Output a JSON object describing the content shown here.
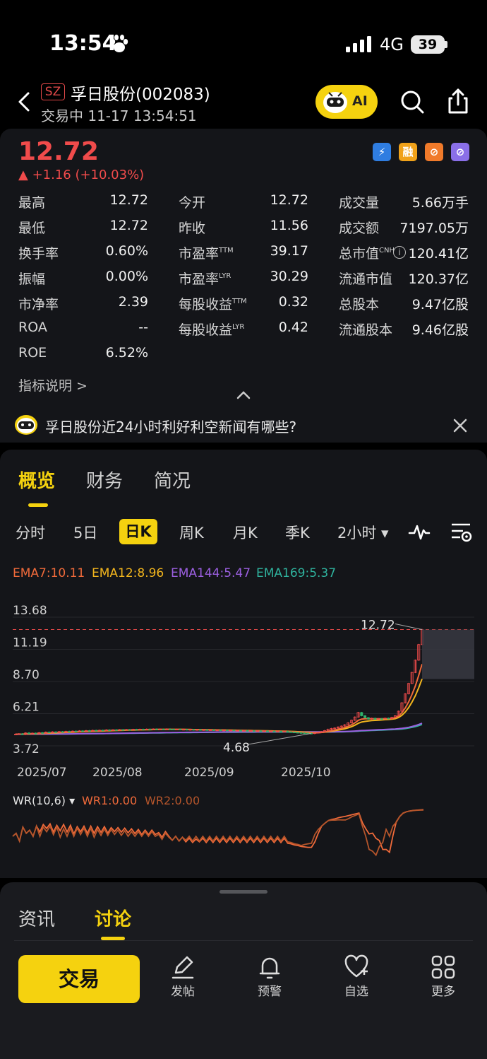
{
  "status": {
    "time": "13:54",
    "network": "4G",
    "battery": "39"
  },
  "header": {
    "market": "SZ",
    "name": "孚日股份(002083)",
    "subtitle": "交易中 11-17 13:54:51",
    "ai_label": "AI"
  },
  "quote": {
    "price": "12.72",
    "change": "▲ +1.16 (+10.03%)",
    "badges": [
      "⚡",
      "融",
      "⊘",
      "⊘"
    ],
    "stats": [
      [
        {
          "label": "最高",
          "value": "12.72"
        },
        {
          "label": "今开",
          "value": "12.72"
        },
        {
          "label": "成交量",
          "value": "5.66万手"
        }
      ],
      [
        {
          "label": "最低",
          "value": "12.72"
        },
        {
          "label": "昨收",
          "value": "11.56"
        },
        {
          "label": "成交额",
          "value": "7197.05万"
        }
      ],
      [
        {
          "label": "换手率",
          "value": "0.60%"
        },
        {
          "label": "市盈率",
          "sup": "TTM",
          "value": "39.17"
        },
        {
          "label": "总市值",
          "sup": "CNH",
          "value": "120.41亿"
        }
      ],
      [
        {
          "label": "振幅",
          "value": "0.00%"
        },
        {
          "label": "市盈率",
          "sup": "LYR",
          "value": "30.29"
        },
        {
          "label": "流通市值",
          "value": "120.37亿"
        }
      ],
      [
        {
          "label": "市净率",
          "value": "2.39"
        },
        {
          "label": "每股收益",
          "sup": "TTM",
          "value": "0.32"
        },
        {
          "label": "总股本",
          "value": "9.47亿股"
        }
      ],
      [
        {
          "label": "ROA",
          "value": "--"
        },
        {
          "label": "每股收益",
          "sup": "LYR",
          "value": "0.42"
        },
        {
          "label": "流通股本",
          "value": "9.46亿股"
        }
      ],
      [
        {
          "label": "ROE",
          "value": "6.52%"
        }
      ]
    ],
    "explain_link": "指标说明 >"
  },
  "news": {
    "text": "孚日股份近24小时利好利空新闻有哪些?"
  },
  "tabs": [
    "概览",
    "财务",
    "简况"
  ],
  "periods": [
    "分时",
    "5日",
    "日K",
    "周K",
    "月K",
    "季K",
    "2小时 ▾"
  ],
  "active_period": "日K",
  "ema": [
    {
      "label": "EMA7:10.11",
      "color": "#f06a3a"
    },
    {
      "label": "EMA12:8.96",
      "color": "#f2b51d"
    },
    {
      "label": "EMA144:5.47",
      "color": "#9b5fe0"
    },
    {
      "label": "EMA169:5.37",
      "color": "#2fb39e"
    }
  ],
  "chart_data": [
    {
      "type": "candlestick",
      "y_ticks": [
        "13.68",
        "11.19",
        "8.70",
        "6.21",
        "3.72"
      ],
      "x_ticks": [
        "2025/07",
        "2025/08",
        "2025/09",
        "2025/10"
      ],
      "ylim": [
        3.72,
        13.68
      ],
      "last_price_label": "12.72",
      "low_label": "4.68",
      "closes": [
        4.62,
        4.65,
        4.6,
        4.72,
        4.68,
        4.7,
        4.66,
        4.74,
        4.7,
        4.78,
        4.75,
        4.8,
        4.76,
        4.82,
        4.78,
        4.84,
        4.8,
        4.86,
        4.82,
        4.88,
        4.85,
        4.9,
        4.86,
        4.92,
        4.88,
        4.93,
        4.9,
        4.95,
        4.92,
        4.96,
        4.94,
        4.97,
        4.95,
        4.98,
        4.96,
        4.99,
        4.97,
        5.0,
        4.98,
        5.01,
        4.99,
        5.02,
        5.0,
        5.01,
        4.99,
        5.02,
        5.0,
        4.98,
        5.0,
        4.97,
        4.99,
        4.96,
        4.98,
        4.95,
        4.97,
        4.94,
        4.96,
        4.93,
        4.95,
        4.92,
        4.94,
        4.91,
        4.93,
        4.9,
        4.92,
        4.89,
        4.91,
        4.88,
        4.9,
        4.87,
        4.89,
        4.86,
        4.88,
        4.85,
        4.87,
        4.84,
        4.86,
        4.83,
        4.85,
        4.82,
        4.84,
        4.8,
        4.78,
        4.76,
        4.74,
        4.72,
        4.7,
        4.69,
        4.68,
        4.72,
        4.76,
        4.82,
        4.9,
        5.0,
        5.06,
        5.1,
        5.18,
        5.25,
        5.35,
        5.5,
        5.7,
        5.95,
        6.3,
        6.05,
        5.9,
        5.8,
        5.85,
        5.78,
        5.82,
        5.8,
        5.86,
        5.82,
        5.92,
        6.05,
        6.4,
        7.05,
        7.75,
        8.55,
        9.4,
        10.35,
        11.56,
        12.72
      ],
      "series": [
        {
          "name": "EMA7",
          "color": "#f06a3a"
        },
        {
          "name": "EMA12",
          "color": "#f2b51d"
        },
        {
          "name": "EMA144",
          "color": "#9b5fe0"
        },
        {
          "name": "EMA169",
          "color": "#2fb39e"
        }
      ]
    },
    {
      "type": "line",
      "title": "WR(10,6) ▾",
      "series": [
        {
          "name": "WR1:0.00",
          "color": "#f06a3a"
        },
        {
          "name": "WR2:0.00",
          "color": "#b5552b"
        }
      ]
    }
  ],
  "bottom": {
    "tabs": [
      "资讯",
      "讨论"
    ],
    "trade_label": "交易",
    "tools": [
      "发帖",
      "预警",
      "自选",
      "更多"
    ]
  }
}
